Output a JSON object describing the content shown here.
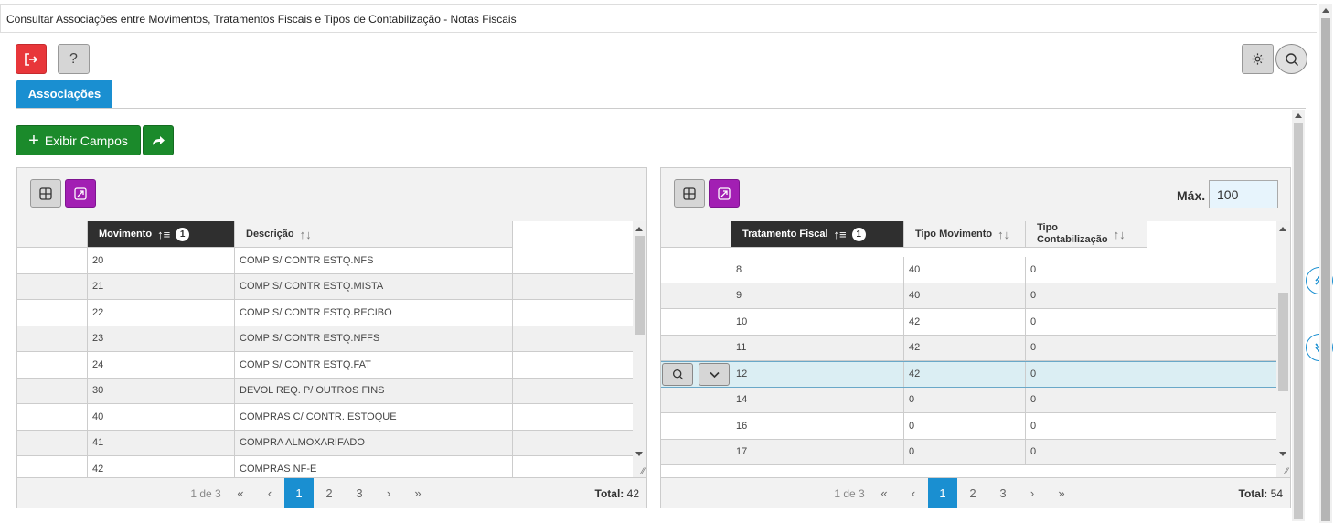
{
  "window": {
    "title": "Consultar Associações entre Movimentos, Tratamentos Fiscais e Tipos de Contabilização - Notas Fiscais"
  },
  "toolbar": {
    "help_label": "?"
  },
  "tabs": [
    {
      "label": "Associações",
      "active": true
    }
  ],
  "actions": {
    "exibir_label": "Exibir Campos"
  },
  "left_grid": {
    "columns": [
      {
        "label": "Movimento",
        "sorted": true,
        "sort_order": "1"
      },
      {
        "label": "Descrição",
        "sorted": false
      }
    ],
    "rows": [
      {
        "mov": "20",
        "desc": "COMP S/ CONTR ESTQ.NFS"
      },
      {
        "mov": "21",
        "desc": "COMP S/ CONTR ESTQ.MISTA"
      },
      {
        "mov": "22",
        "desc": "COMP S/ CONTR ESTQ.RECIBO"
      },
      {
        "mov": "23",
        "desc": "COMP S/ CONTR ESTQ.NFFS"
      },
      {
        "mov": "24",
        "desc": "COMP S/ CONTR ESTQ.FAT"
      },
      {
        "mov": "30",
        "desc": "DEVOL REQ. P/ OUTROS FINS"
      },
      {
        "mov": "40",
        "desc": "COMPRAS C/ CONTR. ESTOQUE"
      },
      {
        "mov": "41",
        "desc": "COMPRA ALMOXARIFADO"
      },
      {
        "mov": "42",
        "desc": "COMPRAS NF-E"
      }
    ],
    "pager": {
      "info": "1 de 3",
      "pages": [
        "1",
        "2",
        "3"
      ],
      "current": "1",
      "total_label": "Total:",
      "total": "42"
    }
  },
  "right_grid": {
    "max_label": "Máx.",
    "max_value": "100",
    "columns": [
      {
        "label": "Tratamento Fiscal",
        "sorted": true,
        "sort_order": "1"
      },
      {
        "label": "Tipo Movimento",
        "sorted": false
      },
      {
        "label_line1": "Tipo",
        "label_line2": "Contabilização",
        "sorted": false
      }
    ],
    "rows": [
      {
        "trat": "8",
        "tipo": "40",
        "cont": "0"
      },
      {
        "trat": "9",
        "tipo": "40",
        "cont": "0"
      },
      {
        "trat": "10",
        "tipo": "42",
        "cont": "0"
      },
      {
        "trat": "11",
        "tipo": "42",
        "cont": "0"
      },
      {
        "trat": "12",
        "tipo": "42",
        "cont": "0",
        "selected": true
      },
      {
        "trat": "14",
        "tipo": "0",
        "cont": "0"
      },
      {
        "trat": "16",
        "tipo": "0",
        "cont": "0"
      },
      {
        "trat": "17",
        "tipo": "0",
        "cont": "0"
      }
    ],
    "pager": {
      "info": "1 de 3",
      "pages": [
        "1",
        "2",
        "3"
      ],
      "current": "1",
      "total_label": "Total:",
      "total": "54"
    }
  },
  "colors": {
    "accent": "#1a8fd1",
    "exit": "#e8363a",
    "green": "#1b8a2b",
    "purple": "#a21fb3",
    "header_dark": "#2f2f2f"
  }
}
